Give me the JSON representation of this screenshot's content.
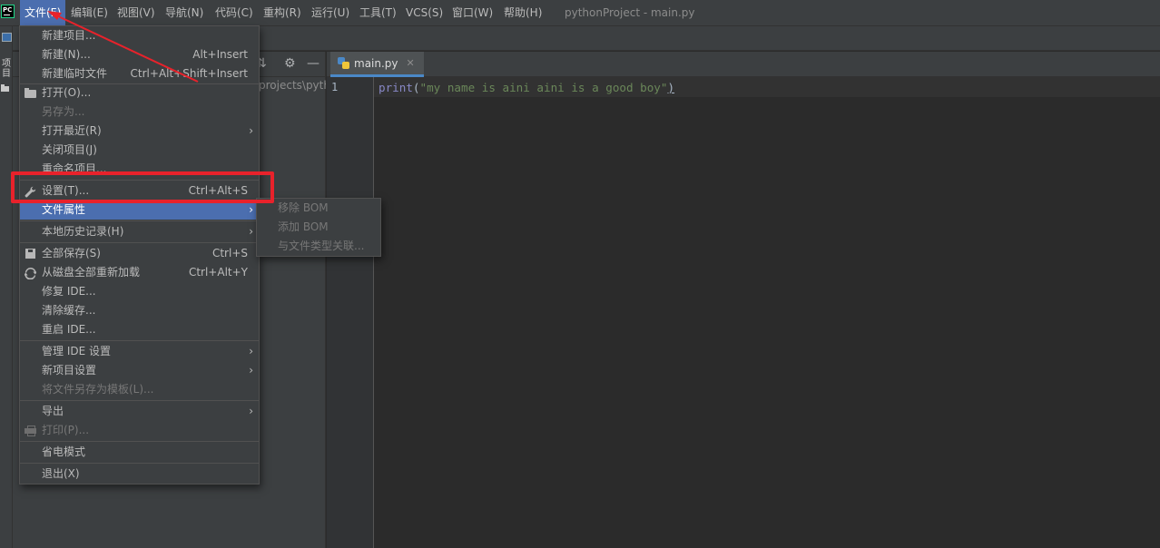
{
  "menubar": {
    "logo": "PC",
    "items": [
      {
        "label": "文件(F)",
        "active": true
      },
      {
        "label": "编辑(E)"
      },
      {
        "label": "视图(V)"
      },
      {
        "label": "导航(N)"
      },
      {
        "label": "代码(C)"
      },
      {
        "label": "重构(R)"
      },
      {
        "label": "运行(U)"
      },
      {
        "label": "工具(T)"
      },
      {
        "label": "VCS(S)"
      },
      {
        "label": "窗口(W)"
      },
      {
        "label": "帮助(H)"
      }
    ],
    "window_title": "pythonProject - main.py"
  },
  "stripe": {
    "label": "项目"
  },
  "project_panel": {
    "path_text": "projects\\pytho"
  },
  "editor": {
    "tab_label": "main.py",
    "line_number": "1",
    "code": {
      "keyword": "print",
      "open_paren": "(",
      "string": "\"my name is aini aini is a good boy\"",
      "close_paren": ")"
    }
  },
  "file_menu": {
    "items": [
      {
        "label": "新建项目..."
      },
      {
        "label": "新建(N)...",
        "shortcut": "Alt+Insert"
      },
      {
        "label": "新建临时文件",
        "shortcut": "Ctrl+Alt+Shift+Insert"
      },
      {
        "label": "打开(O)...",
        "icon": "folder-icon"
      },
      {
        "label": "另存为...",
        "disabled": true
      },
      {
        "label": "打开最近(R)",
        "submenu": true
      },
      {
        "label": "关闭项目(J)"
      },
      {
        "label": "重命名项目..."
      },
      {
        "label": "设置(T)...",
        "shortcut": "Ctrl+Alt+S",
        "icon": "wrench-icon"
      },
      {
        "label": "文件属性",
        "submenu": true,
        "selected": true
      },
      {
        "label": "本地历史记录(H)",
        "submenu": true
      },
      {
        "label": "全部保存(S)",
        "shortcut": "Ctrl+S",
        "icon": "save-icon"
      },
      {
        "label": "从磁盘全部重新加载",
        "shortcut": "Ctrl+Alt+Y",
        "icon": "reload-icon"
      },
      {
        "label": "修复 IDE..."
      },
      {
        "label": "清除缓存..."
      },
      {
        "label": "重启 IDE..."
      },
      {
        "label": "管理 IDE 设置",
        "submenu": true
      },
      {
        "label": "新项目设置",
        "submenu": true
      },
      {
        "label": "将文件另存为模板(L)...",
        "disabled": true
      },
      {
        "label": "导出",
        "submenu": true
      },
      {
        "label": "打印(P)...",
        "disabled": true,
        "icon": "print-icon"
      },
      {
        "label": "省电模式"
      },
      {
        "label": "退出(X)"
      }
    ]
  },
  "file_properties_submenu": {
    "items": [
      {
        "label": "移除 BOM",
        "disabled": true
      },
      {
        "label": "添加 BOM",
        "disabled": true
      },
      {
        "label": "与文件类型关联...",
        "disabled": true
      }
    ]
  },
  "colors": {
    "highlight": "#4b6eaf",
    "annotation": "#e8222b",
    "background": "#2b2b2b",
    "panel": "#3c3f41"
  }
}
